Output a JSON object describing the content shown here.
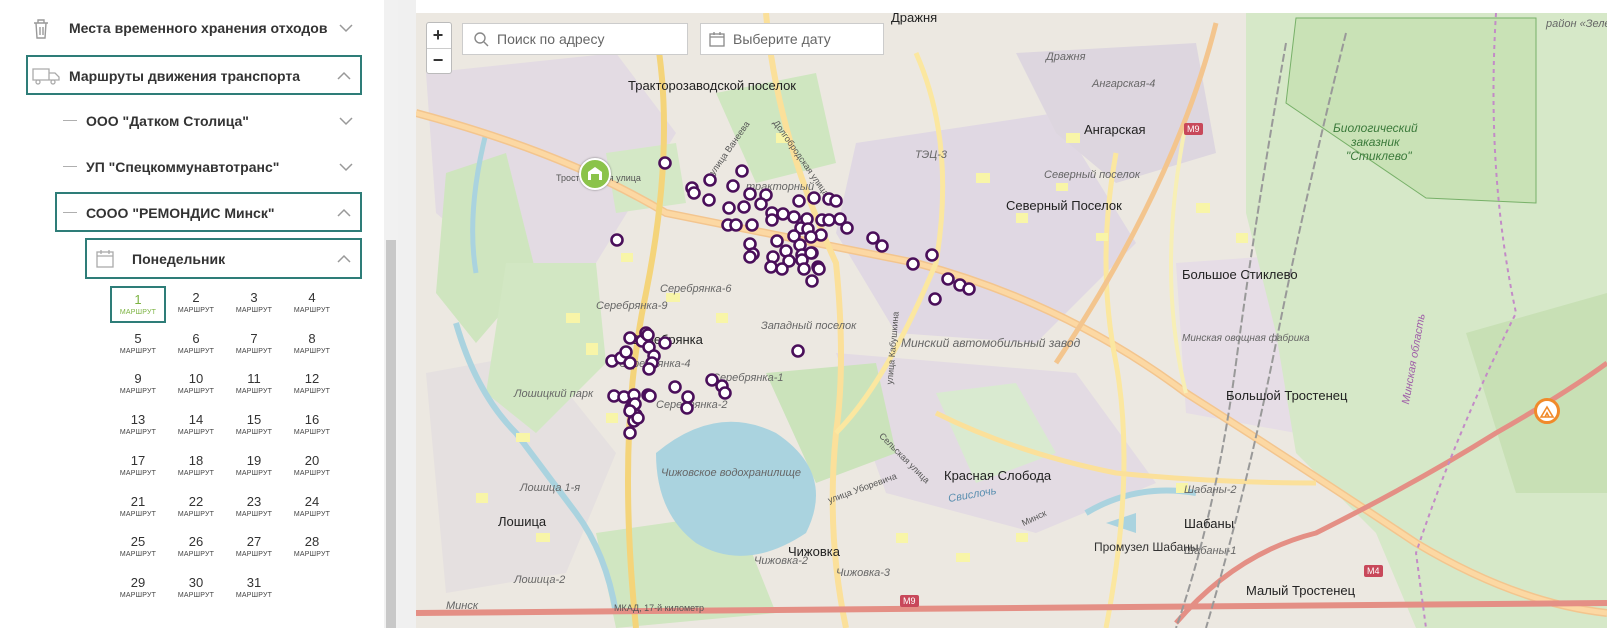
{
  "sidebar": {
    "waste_storage": {
      "label": "Места временного хранения отходов"
    },
    "transport_routes": {
      "label": "Маршруты движения транспорта"
    },
    "companies": [
      {
        "label": "ООО \"Датком Столица\""
      },
      {
        "label": "УП \"Спецкоммунавтотранс\""
      },
      {
        "label": "СООО \"РЕМОНДИС Минск\""
      }
    ],
    "weekday": {
      "label": "Понедельник"
    },
    "route_label": "МАРШРУТ",
    "selected_day": "1",
    "days": [
      "1",
      "2",
      "3",
      "4",
      "5",
      "6",
      "7",
      "8",
      "9",
      "10",
      "11",
      "12",
      "13",
      "14",
      "15",
      "16",
      "17",
      "18",
      "19",
      "20",
      "21",
      "22",
      "23",
      "24",
      "25",
      "26",
      "27",
      "28",
      "29",
      "30",
      "31"
    ]
  },
  "map": {
    "search": {
      "placeholder": "Поиск по адресу"
    },
    "date": {
      "placeholder": "Выберите дату"
    },
    "zoom_in": "+",
    "zoom_out": "−",
    "marker_color": "#4a0f5a",
    "labels": {
      "drazhnya": "Дражня",
      "traktorny": "Тракторозаводской поселок",
      "traktorny2": "тракторный",
      "drazhnya_small": "Дражня",
      "angarskaya4": "Ангарская-4",
      "angarskaya": "Ангарская",
      "tec3": "ТЭЦ-3",
      "severny_small": "Северный поселок",
      "severny": "Северный Поселок",
      "big_stiklevo": "Большое Стиклево",
      "serebryanka9": "Серебрянка-9",
      "serebryanka6": "Серебрянка-6",
      "serebryanka": "Серебрянка",
      "serebryanka4": "Серебрянка-4",
      "serebryanka1": "Серебрянка-1",
      "serebryanka2": "Серебрянка-2",
      "zapadny": "Западный поселок",
      "maz": "Минский автомобильный завод",
      "vegetable": "Минская овощная фабрика",
      "big_trostenets": "Большой Тростенец",
      "loshitsky_park": "Лошицкий парк",
      "chizhovskoe": "Чижовское водохранилище",
      "krasnaya": "Красная Слобода",
      "loshitsa1": "Лошица 1-я",
      "loshitsa": "Лошица",
      "loshitsa2": "Лошица-2",
      "chizhovka": "Чижовка",
      "chizhovka2": "Чижовка-2",
      "chizhovka3": "Чижовка-3",
      "promuzel": "Промузел Шабаны",
      "shabany2": "Шабаны-2",
      "shabany": "Шабаны",
      "shabany1": "Шабаны-1",
      "maly_trostenets": "Малый Тростенец",
      "zelenaya": "район «Зеленая гавань»",
      "bio1": "Биологический",
      "bio2": "заказник",
      "bio3": "\"Стиклево\"",
      "minsk_region": "Минская область",
      "m9a": "M9",
      "m9b": "M9",
      "m4": "M4",
      "minsk_bl": "Минск",
      "mkad": "МКАД, 17-й километр",
      "trostenetskaya": "Тростенецкая улица",
      "vaneeva": "улица Ванеева",
      "dolgobrodskaya": "Долгобродская улица",
      "kabushkina": "улица Кабушкина",
      "seleckaya": "Сельская улица",
      "uborevicha": "улица Уборевича",
      "svisloch": "Свислочь",
      "minsk_road": "Минск",
      "nikolaevskaya": "улица Кольцова"
    }
  }
}
